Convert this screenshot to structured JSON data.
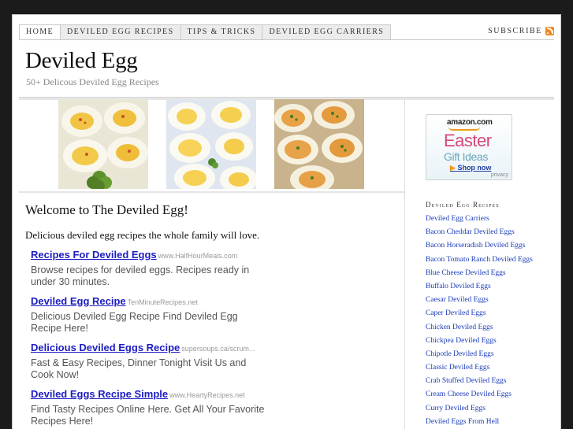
{
  "nav": {
    "tabs": [
      {
        "label": "Home"
      },
      {
        "label": "Deviled Egg Recipes"
      },
      {
        "label": "Tips & Tricks"
      },
      {
        "label": "Deviled Egg Carriers"
      }
    ],
    "subscribe": "SUBSCRIBE"
  },
  "header": {
    "title": "Deviled Egg",
    "tagline": "50+ Delicous Deviled Egg Recipes"
  },
  "main": {
    "welcome": "Welcome to The Deviled Egg!",
    "intro": "Delicious deviled egg recipes the whole family will love.",
    "ads": [
      {
        "title": "Recipes For Deviled Eggs",
        "url": "www.HalfHourMeals.com",
        "desc": "Browse recipes for deviled eggs. Recipes ready in under 30 minutes."
      },
      {
        "title": "Deviled Egg Recipe",
        "url": "TenMinuteRecipes.net",
        "desc": "Delicious Deviled Egg Recipe Find Deviled Egg Recipe Here!"
      },
      {
        "title": "Delicious Deviled Eggs Recipe",
        "url": "supersoups.ca/scrum...",
        "desc": "Fast & Easy Recipes, Dinner Tonight Visit Us and Cook Now!"
      },
      {
        "title": "Deviled Eggs Recipe Simple",
        "url": "www.HeartyRecipes.net",
        "desc": "Find Tasty Recipes Online Here. Get All Your Favorite Recipes Here!"
      }
    ]
  },
  "sidebar": {
    "amazon": {
      "logo": "amazon.com",
      "line1": "Easter",
      "line2": "Gift Ideas",
      "shop": "Shop now",
      "privacy": "privacy"
    },
    "heading": "Deviled Egg Recipes",
    "items": [
      "Deviled Egg Carriers",
      "Bacon Cheddar Deviled Eggs",
      "Bacon Horseradish Deviled Eggs",
      "Bacon Tomato Ranch Deviled Eggs",
      "Blue Cheese Deviled Eggs",
      "Buffalo Deviled Eggs",
      "Caesar Deviled Eggs",
      "Caper Deviled Eggs",
      "Chicken Deviled Eggs",
      "Chickpea Deviled Eggs",
      "Chipotle Deviled Eggs",
      "Classic Deviled Eggs",
      "Crab Stuffed Deviled Eggs",
      "Cream Cheese Deviled Eggs",
      "Curry Deviled Eggs",
      "Deviled Eggs From Hell"
    ]
  },
  "colors": {
    "link": "#1a3bb8",
    "ad_title": "#1d1dc4",
    "page_bg": "#1b1b1b"
  }
}
